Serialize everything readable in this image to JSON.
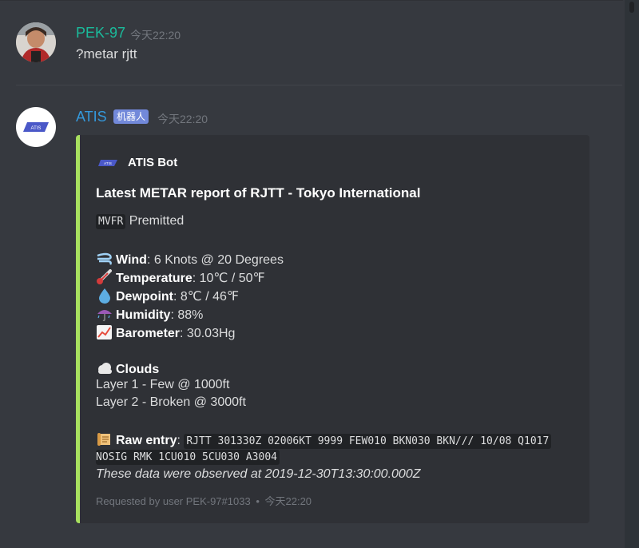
{
  "colors": {
    "background": "#36393f",
    "embed_bg": "#2f3136",
    "embed_accent": "#a8e05f",
    "user1_name": "#1abc9c",
    "bot_name": "#3498db",
    "badge_bg": "#7289da"
  },
  "message1": {
    "username": "PEK-97",
    "timestamp": "今天22:20",
    "text": "?metar rjtt"
  },
  "message2": {
    "username": "ATIS",
    "badge": "机器人",
    "timestamp": "今天22:20"
  },
  "embed": {
    "author": "ATIS Bot",
    "title": "Latest METAR report of RJTT - Tokyo International",
    "flight_rules_code": "MVFR",
    "flight_rules_text": "Premitted",
    "fields": [
      {
        "icon": "wind-icon",
        "label": "Wind",
        "value": ": 6 Knots @ 20 Degrees"
      },
      {
        "icon": "thermometer-icon",
        "label": "Temperature",
        "value": ": 10℃ / 50℉"
      },
      {
        "icon": "droplet-icon",
        "label": "Dewpoint",
        "value": ": 8℃ / 46℉"
      },
      {
        "icon": "umbrella-icon",
        "label": "Humidity",
        "value": ": 88%"
      },
      {
        "icon": "chart-increasing-icon",
        "label": "Barometer",
        "value": ": 30.03Hg"
      }
    ],
    "clouds_label": "Clouds",
    "cloud_layers": [
      "Layer 1 - Few @ 1000ft",
      "Layer 2 - Broken @ 3000ft"
    ],
    "raw_label": "Raw entry",
    "raw_line1": "RJTT 301330Z 02006KT 9999 FEW010 BKN030 BKN/// 10/08 Q1017",
    "raw_line2": "NOSIG RMK 1CU010 5CU030 A3004",
    "observed": "These data were observed at 2019-12-30T13:30:00.000Z",
    "footer_text": "Requested by user PEK-97#1033",
    "footer_sep": "•",
    "footer_time": "今天22:20"
  }
}
